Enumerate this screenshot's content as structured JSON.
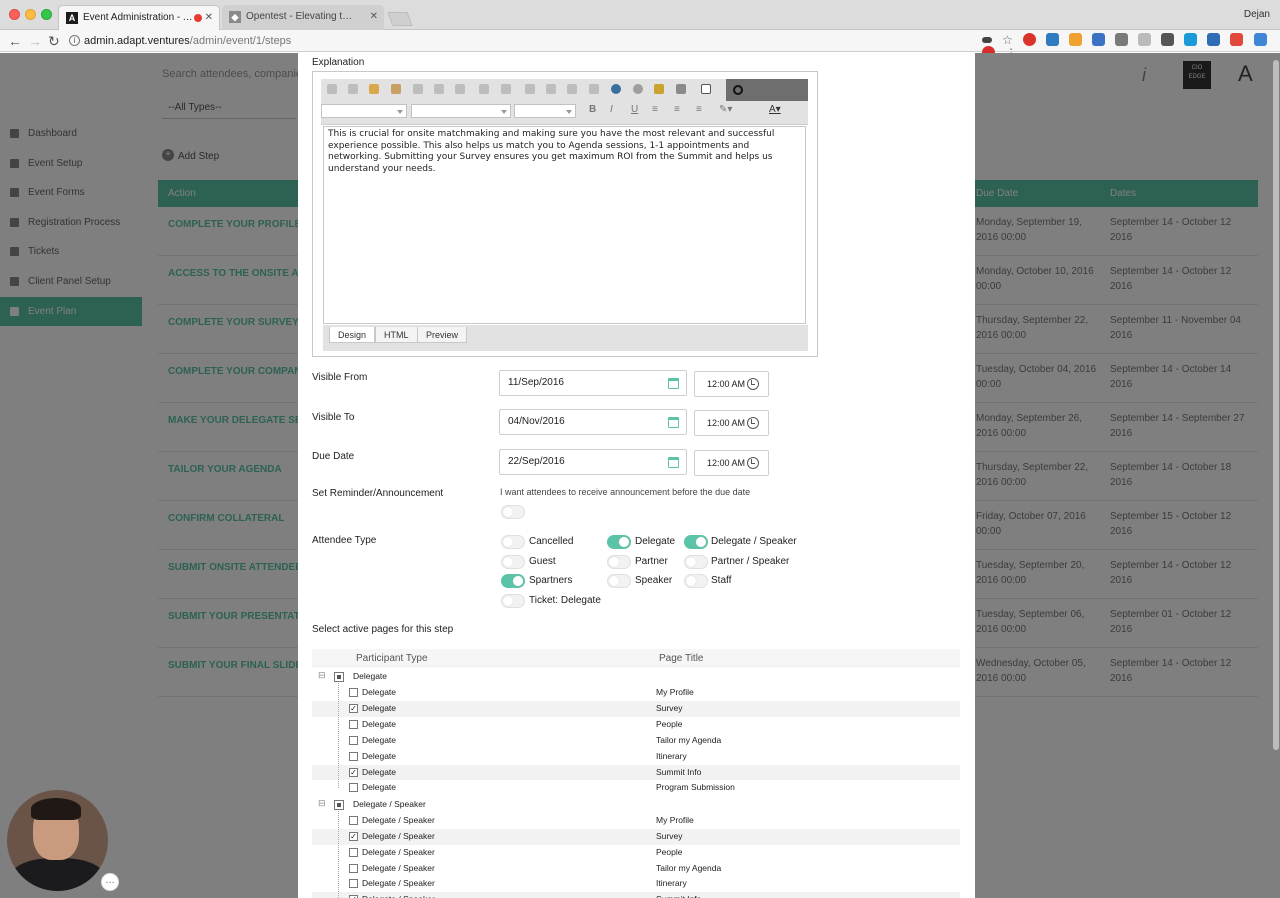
{
  "browser": {
    "tabs": [
      {
        "title": "Event Administration - Adap",
        "icon": "adapt-favicon"
      },
      {
        "title": "Opentest - Elevating the prod",
        "icon": "opentest-favicon"
      }
    ],
    "user": "Dejan",
    "url_host": "admin.adapt.ventures",
    "url_path": "/admin/event/1/steps"
  },
  "background": {
    "search_placeholder": "Search attendees, companies",
    "type_filter": "--All Types--",
    "add_step": "Add Step",
    "badge": "CIO EDGE",
    "logo": "A",
    "sidebar": [
      {
        "label": "Dashboard",
        "active": false
      },
      {
        "label": "Event Setup",
        "active": false
      },
      {
        "label": "Event Forms",
        "active": false
      },
      {
        "label": "Registration Process",
        "active": false
      },
      {
        "label": "Tickets",
        "active": false
      },
      {
        "label": "Client Panel Setup",
        "active": false
      },
      {
        "label": "Event Plan",
        "active": true
      }
    ],
    "table_headers": {
      "action": "Action",
      "due_date": "Due Date",
      "dates": "Dates"
    },
    "rows": [
      {
        "action": "COMPLETE YOUR PROFILE",
        "due": "Monday, September 19, 2016 00:00",
        "dates": "September 14 - October 12 2016"
      },
      {
        "action": "ACCESS TO THE ONSITE APP",
        "due": "Monday, October 10, 2016 00:00",
        "dates": "September 14 - October 12 2016"
      },
      {
        "action": "COMPLETE YOUR SURVEY",
        "due": "Thursday, September 22, 2016 00:00",
        "dates": "September 11 - November 04 2016"
      },
      {
        "action": "COMPLETE YOUR COMPANY",
        "due": "Tuesday, October 04, 2016 00:00",
        "dates": "September 14 - October 14 2016"
      },
      {
        "action": "MAKE YOUR DELEGATE SELE",
        "due": "Monday, September 26, 2016 00:00",
        "dates": "September 14 - September 27 2016"
      },
      {
        "action": "TAILOR YOUR AGENDA",
        "due": "Thursday, September 22, 2016 00:00",
        "dates": "September 14 - October 18 2016"
      },
      {
        "action": "CONFIRM COLLATERAL",
        "due": "Friday, October 07, 2016 00:00",
        "dates": "September 15 - October 12 2016"
      },
      {
        "action": "SUBMIT ONSITE ATTENDEE P",
        "due": "Tuesday, September 20, 2016 00:00",
        "dates": "September 14 - October 12 2016"
      },
      {
        "action": "SUBMIT YOUR PRESENTATIO",
        "due": "Tuesday, September 06, 2016 00:00",
        "dates": "September 01 - October 12 2016"
      },
      {
        "action": "SUBMIT YOUR FINAL SLIDE D",
        "due": "Wednesday, October 05, 2016 00:00",
        "dates": "September 14 - October 12 2016"
      }
    ]
  },
  "modal": {
    "explanation_label": "Explanation",
    "editor_text": "This is crucial for onsite matchmaking and making sure you have the most relevant and successful experience possible. This also helps us match you to Agenda sessions, 1-1 appointments and networking.  Submitting your Survey ensures you get maximum ROI from the Summit and helps us understand your needs.",
    "editor_tabs": [
      "Design",
      "HTML",
      "Preview"
    ],
    "visible_from": {
      "label": "Visible From",
      "date": "11/Sep/2016",
      "time": "12:00 AM"
    },
    "visible_to": {
      "label": "Visible To",
      "date": "04/Nov/2016",
      "time": "12:00 AM"
    },
    "due_date": {
      "label": "Due Date",
      "date": "22/Sep/2016",
      "time": "12:00 AM"
    },
    "reminder": {
      "label": "Set Reminder/Announcement",
      "text": "I want attendees to receive announcement before the due date",
      "on": false
    },
    "attendee_type_label": "Attendee Type",
    "attendee_types": [
      {
        "label": "Cancelled",
        "on": false
      },
      {
        "label": "Delegate",
        "on": true
      },
      {
        "label": "Delegate / Speaker",
        "on": true
      },
      {
        "label": "Guest",
        "on": false
      },
      {
        "label": "Partner",
        "on": false
      },
      {
        "label": "Partner / Speaker",
        "on": false
      },
      {
        "label": "Spartners",
        "on": true
      },
      {
        "label": "Speaker",
        "on": false
      },
      {
        "label": "Staff",
        "on": false
      },
      {
        "label": "Ticket: Delegate",
        "on": false
      }
    ],
    "pages_label": "Select active pages for this step",
    "grid_headers": {
      "participant": "Participant Type",
      "page": "Page Title"
    },
    "groups": [
      {
        "name": "Delegate",
        "rows": [
          {
            "type": "Delegate",
            "page": "My Profile",
            "checked": false
          },
          {
            "type": "Delegate",
            "page": "Survey",
            "checked": true
          },
          {
            "type": "Delegate",
            "page": "People",
            "checked": false
          },
          {
            "type": "Delegate",
            "page": "Tailor my Agenda",
            "checked": false
          },
          {
            "type": "Delegate",
            "page": "Itinerary",
            "checked": false
          },
          {
            "type": "Delegate",
            "page": "Summit Info",
            "checked": true
          },
          {
            "type": "Delegate",
            "page": "Program Submission",
            "checked": false
          }
        ]
      },
      {
        "name": "Delegate / Speaker",
        "rows": [
          {
            "type": "Delegate / Speaker",
            "page": "My Profile",
            "checked": false
          },
          {
            "type": "Delegate / Speaker",
            "page": "Survey",
            "checked": true
          },
          {
            "type": "Delegate / Speaker",
            "page": "People",
            "checked": false
          },
          {
            "type": "Delegate / Speaker",
            "page": "Tailor my Agenda",
            "checked": false
          },
          {
            "type": "Delegate / Speaker",
            "page": "Itinerary",
            "checked": false
          },
          {
            "type": "Delegate / Speaker",
            "page": "Summit Info",
            "checked": true
          }
        ]
      }
    ]
  },
  "colors": {
    "accent": "#5bc3a8",
    "overlay": "#00000080"
  }
}
